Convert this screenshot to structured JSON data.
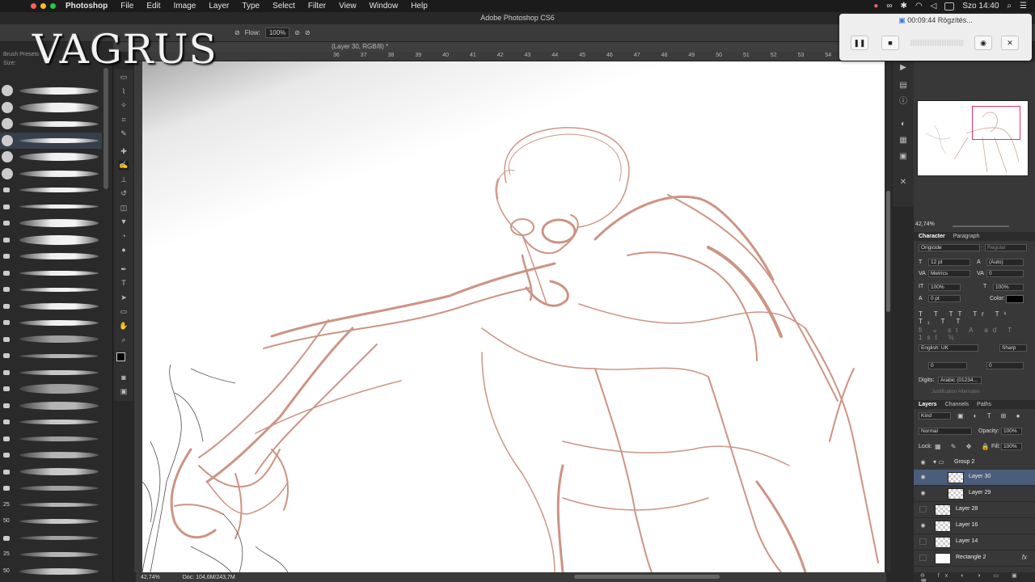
{
  "menubar": {
    "app": "Photoshop",
    "items": [
      "File",
      "Edit",
      "Image",
      "Layer",
      "Type",
      "Select",
      "Filter",
      "View",
      "Window",
      "Help"
    ],
    "clock": "Szo 14:40"
  },
  "window_title": "Adobe Photoshop CS6",
  "options_bar": {
    "flow_label": "Flow:",
    "flow_value": "100%"
  },
  "document_tab": "(Layer 30, RGB/8) *",
  "brush_panel": {
    "label": "Brush Presets",
    "size_label": "Size:",
    "numbers": [
      "25",
      "50",
      "25",
      "50"
    ]
  },
  "ruler_ticks": [
    "36",
    "37",
    "38",
    "39",
    "40",
    "41",
    "42",
    "43",
    "44",
    "45",
    "46",
    "47",
    "48",
    "49",
    "50",
    "51",
    "52",
    "53",
    "54",
    "55"
  ],
  "status": {
    "zoom": "42,74%",
    "doc": "Doc: 104,6M/243,7M"
  },
  "navigator": {
    "zoom": "42,74%"
  },
  "character": {
    "tabs": [
      "Character",
      "Paragraph"
    ],
    "font": "Origicide",
    "style": "Regular",
    "size": "12 pt",
    "leading": "(Auto)",
    "kerning": "Metrics",
    "tracking": "0",
    "vscale": "100%",
    "hscale": "100%",
    "baseline": "0 pt",
    "color_label": "Color:",
    "language": "English: UK",
    "antialias": "Sharp",
    "x1": "0",
    "x2": "0",
    "digits_label": "Digits:",
    "digits_value": "Arabic (01234...",
    "justification": "Justification Alternates"
  },
  "layers": {
    "tabs": [
      "Layers",
      "Channels",
      "Paths"
    ],
    "filter": "Kind",
    "blend_mode": "Normal",
    "opacity_label": "Opacity:",
    "opacity": "100%",
    "lock_label": "Lock:",
    "fill_label": "Fill:",
    "fill": "100%",
    "rows": [
      {
        "name": "Group 2"
      },
      {
        "name": "Layer 30"
      },
      {
        "name": "Layer 29"
      },
      {
        "name": "Layer 28"
      },
      {
        "name": "Layer 16"
      },
      {
        "name": "Layer 14"
      },
      {
        "name": "Rectangle 2"
      }
    ]
  },
  "recorder": {
    "time": "00:09:44 Rögzítés..."
  },
  "logo": {
    "text": "VAGRUS"
  },
  "colors": {
    "sketch": "#c07a66",
    "selection_highlight": "#4b5d7a",
    "nav_box": "#e0306a"
  }
}
